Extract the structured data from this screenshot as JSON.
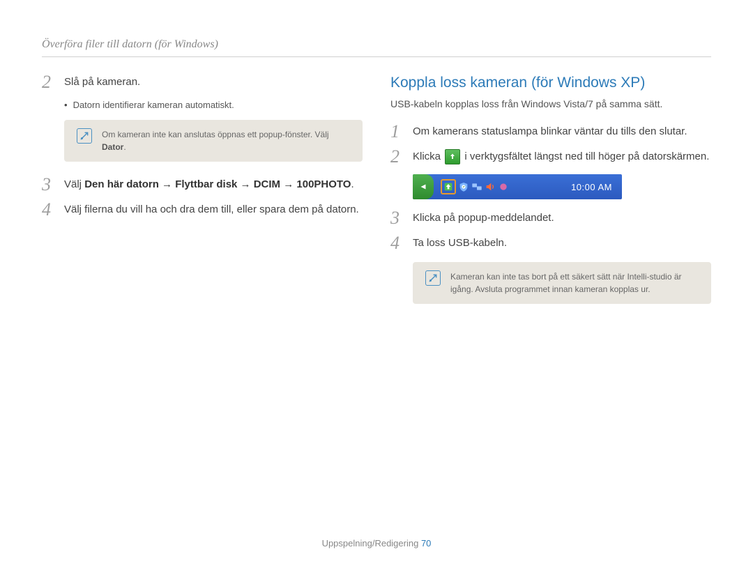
{
  "header": "Överföra filer till datorn (för Windows)",
  "left": {
    "steps": [
      {
        "n": "2",
        "text": "Slå på kameran.",
        "bullet": "Datorn identifierar kameran automatiskt.",
        "note_pre": "Om kameran inte kan anslutas öppnas ett popup-fönster. Välj ",
        "note_bold": "Dator",
        "note_post": "."
      },
      {
        "n": "3",
        "pre": "Välj ",
        "bold": "Den här datorn → Flyttbar disk → DCIM → 100PHOTO",
        "post": "."
      },
      {
        "n": "4",
        "text": "Välj filerna du vill ha och dra dem till, eller spara dem på datorn."
      }
    ]
  },
  "right": {
    "heading": "Koppla loss kameran (för Windows XP)",
    "sub": "USB-kabeln kopplas loss från Windows Vista/7 på samma sätt.",
    "steps": [
      {
        "n": "1",
        "text": "Om kamerans statuslampa blinkar väntar du tills den slutar."
      },
      {
        "n": "2",
        "pre": "Klicka ",
        "post": " i verktygsfältet längst ned till höger på datorskärmen."
      },
      {
        "n": "3",
        "text": "Klicka på popup-meddelandet."
      },
      {
        "n": "4",
        "text": "Ta loss USB-kabeln."
      }
    ],
    "taskbar_clock": "10:00 AM",
    "note": "Kameran kan inte tas bort på ett säkert sätt när Intelli-studio är igång. Avsluta programmet innan kameran kopplas ur."
  },
  "footer": {
    "section": "Uppspelning/Redigering",
    "page": "70"
  }
}
